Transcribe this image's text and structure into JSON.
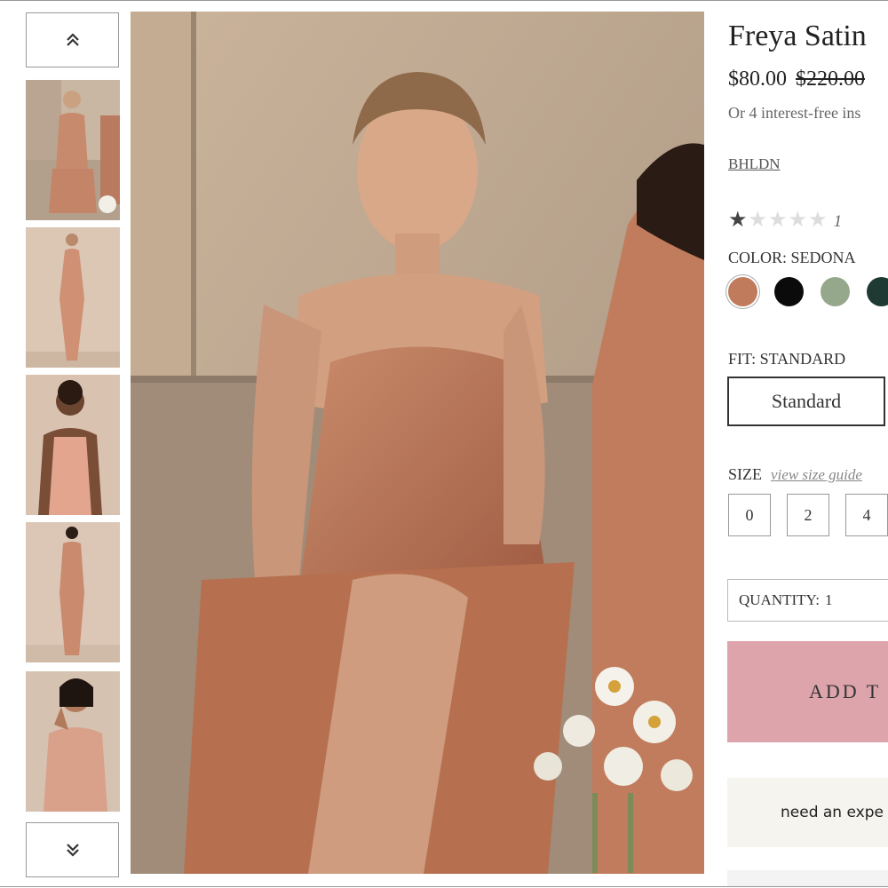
{
  "gallery": {
    "up_icon": "double-chevron-up-icon",
    "down_icon": "double-chevron-down-icon",
    "thumbnails": [
      "thumbnail-1",
      "thumbnail-2",
      "thumbnail-3",
      "thumbnail-4",
      "thumbnail-5"
    ]
  },
  "product": {
    "title": "Freya Satin",
    "price": "$80.00",
    "original_price": "$220.00",
    "installment_text": "Or 4 interest-free ins",
    "brand": "BHLDN",
    "rating": {
      "filled": 1,
      "total": 5,
      "count": "1"
    }
  },
  "color": {
    "label": "COLOR: SEDONA",
    "swatches": [
      {
        "name": "sedona",
        "hex": "#c07a5c"
      },
      {
        "name": "black",
        "hex": "#0b0b0b"
      },
      {
        "name": "sage",
        "hex": "#95a88c"
      },
      {
        "name": "dark-green",
        "hex": "#1f3a33"
      }
    ]
  },
  "fit": {
    "label": "FIT: STANDARD",
    "option": "Standard"
  },
  "size": {
    "label": "SIZE",
    "guide_link": "view size guide",
    "options": [
      "0",
      "2",
      "4"
    ]
  },
  "quantity": {
    "label": "QUANTITY:",
    "value": "1"
  },
  "cta": {
    "add_label": "ADD T",
    "expert_label": "need an expe"
  },
  "colors": {
    "accent_pink": "#dda4ab",
    "expert_bg": "#f6f4ef"
  }
}
